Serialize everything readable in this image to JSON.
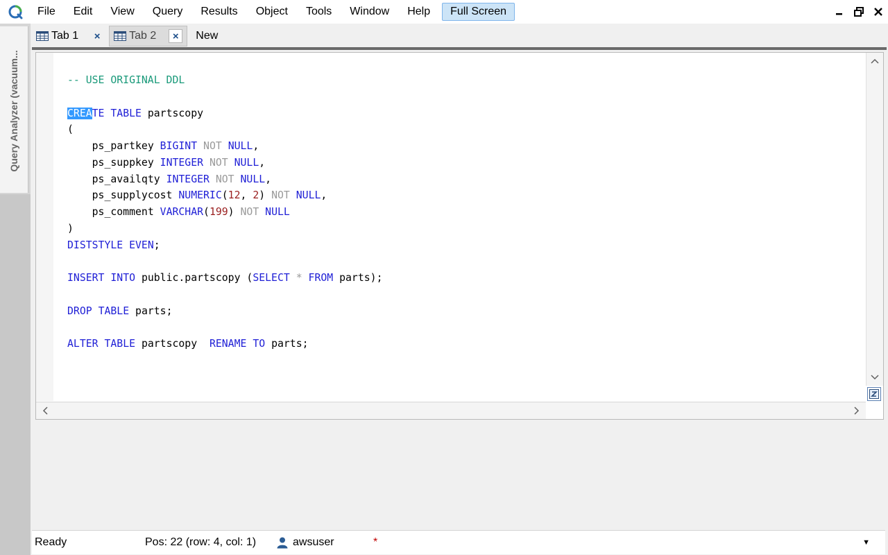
{
  "menu": {
    "items": [
      "File",
      "Edit",
      "View",
      "Query",
      "Results",
      "Object",
      "Tools",
      "Window",
      "Help"
    ],
    "fullscreen_label": "Full Screen"
  },
  "sidebar": {
    "panel_label": "Query Analyzer (vacuum..."
  },
  "tabs": {
    "items": [
      {
        "label": "Tab 1",
        "close": "×",
        "active": false
      },
      {
        "label": "Tab 2",
        "close": "×",
        "active": true
      }
    ],
    "new_label": "New"
  },
  "editor": {
    "lines": [
      "-- USE ORIGINAL DDL",
      "",
      "CREATE TABLE partscopy",
      "(",
      "    ps_partkey BIGINT NOT NULL,",
      "    ps_suppkey INTEGER NOT NULL,",
      "    ps_availqty INTEGER NOT NULL,",
      "    ps_supplycost NUMERIC(12, 2) NOT NULL,",
      "    ps_comment VARCHAR(199) NOT NULL",
      ")",
      "DISTSTYLE EVEN;",
      "",
      "INSERT INTO public.partscopy (SELECT * FROM parts);",
      "",
      "DROP TABLE parts;",
      "",
      "ALTER TABLE partscopy  RENAME TO parts;"
    ],
    "selected_text": "CREA"
  },
  "status": {
    "ready": "Ready",
    "position": "Pos: 22 (row: 4, col: 1)",
    "user": "awsuser",
    "modified_marker": "*"
  },
  "colors": {
    "keyword": "#1f1fd6",
    "comment": "#1a9a7a",
    "number": "#9a1f1f",
    "muted_keyword": "#9a9a9a",
    "selection": "#3399ff",
    "fullscreen_highlight": "#cce4f7"
  },
  "icons": {
    "app": "app-logo-icon",
    "tab": "table-grid-icon",
    "close": "close-icon",
    "user": "user-icon",
    "split": "split-view-icon"
  }
}
